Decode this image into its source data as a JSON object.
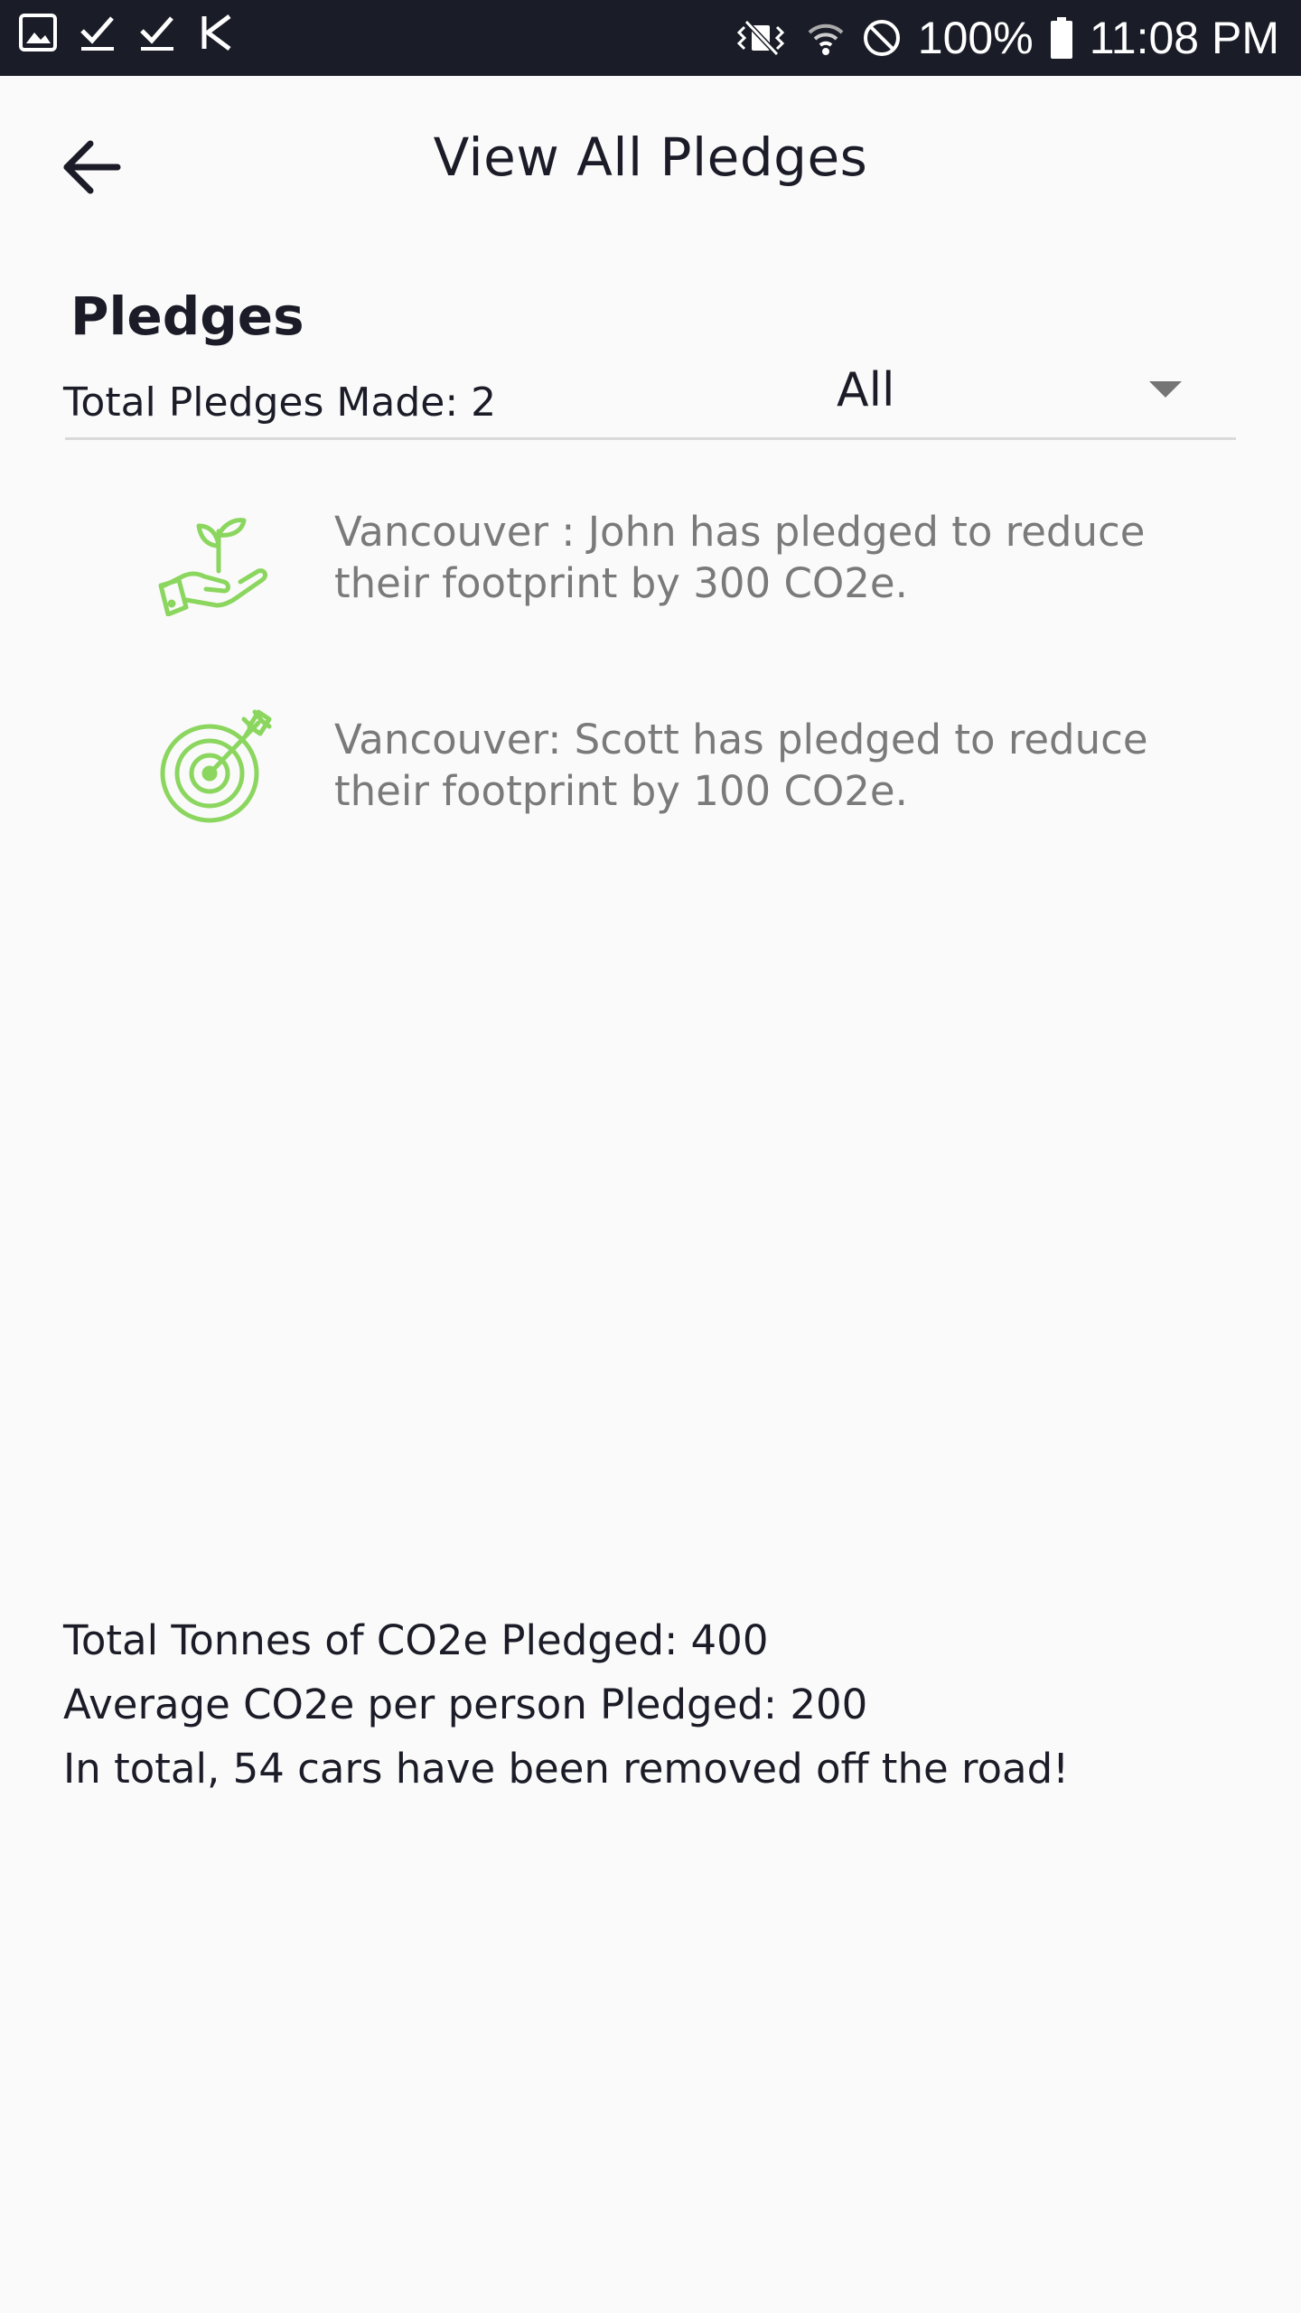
{
  "status_bar": {
    "battery": "100%",
    "time": "11:08 PM",
    "left_icons": [
      "image-icon",
      "check-icon",
      "check-icon",
      "k-icon"
    ],
    "right_icons": [
      "vibrate-icon",
      "wifi-icon",
      "do-not-disturb-icon",
      "battery-icon"
    ]
  },
  "header": {
    "title": "View All Pledges",
    "back_icon": "arrow-left-icon"
  },
  "pledges": {
    "section_title": "Pledges",
    "total_label": "Total Pledges Made: 2",
    "filter": {
      "selected": "All"
    },
    "items": [
      {
        "icon": "plant-in-hand-icon",
        "text": "Vancouver : John has pledged to reduce their footprint by 300 CO2e."
      },
      {
        "icon": "target-icon",
        "text": "Vancouver: Scott has pledged to reduce their footprint by 100 CO2e."
      }
    ]
  },
  "summary": {
    "total_tonnes": "Total Tonnes of CO2e Pledged: 400",
    "average": "Average CO2e per person Pledged: 200",
    "cars_removed": "In total, 54 cars have been removed off the road!"
  },
  "colors": {
    "status_bar_bg": "#1a1d28",
    "background": "#fafafa",
    "icon_green": "#8bd65e",
    "text_primary": "#1c1c28",
    "text_secondary": "#7a7a7a"
  }
}
